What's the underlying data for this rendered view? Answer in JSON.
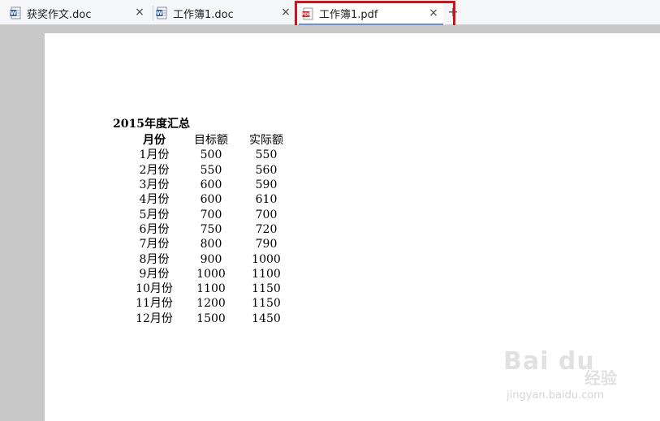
{
  "tabs": [
    {
      "label": "获奖作文.doc",
      "type": "doc",
      "active": false
    },
    {
      "label": "工作簿1.doc",
      "type": "doc",
      "active": false
    },
    {
      "label": "工作簿1.pdf",
      "type": "pdf",
      "active": true
    }
  ],
  "close_glyph": "×",
  "new_tab_glyph": "+",
  "document": {
    "title": "2015年度汇总",
    "columns": [
      "月份",
      "目标额",
      "实际额"
    ],
    "rows": [
      [
        "1月份",
        "500",
        "550"
      ],
      [
        "2月份",
        "550",
        "560"
      ],
      [
        "3月份",
        "600",
        "590"
      ],
      [
        "4月份",
        "600",
        "610"
      ],
      [
        "5月份",
        "700",
        "700"
      ],
      [
        "6月份",
        "750",
        "720"
      ],
      [
        "7月份",
        "800",
        "790"
      ],
      [
        "8月份",
        "900",
        "1000"
      ],
      [
        "9月份",
        "1000",
        "1100"
      ],
      [
        "10月份",
        "1100",
        "1150"
      ],
      [
        "11月份",
        "1200",
        "1150"
      ],
      [
        "12月份",
        "1500",
        "1450"
      ]
    ]
  },
  "watermark": {
    "logo": "Bai du",
    "cn": "经验",
    "url": "jingyan.baidu.com"
  },
  "colors": {
    "highlight": "#d0121b",
    "page_bg": "#ffffff",
    "workspace_bg": "#c8c8c8",
    "doc_icon": "#2b5797",
    "pdf_icon": "#c8202b"
  }
}
